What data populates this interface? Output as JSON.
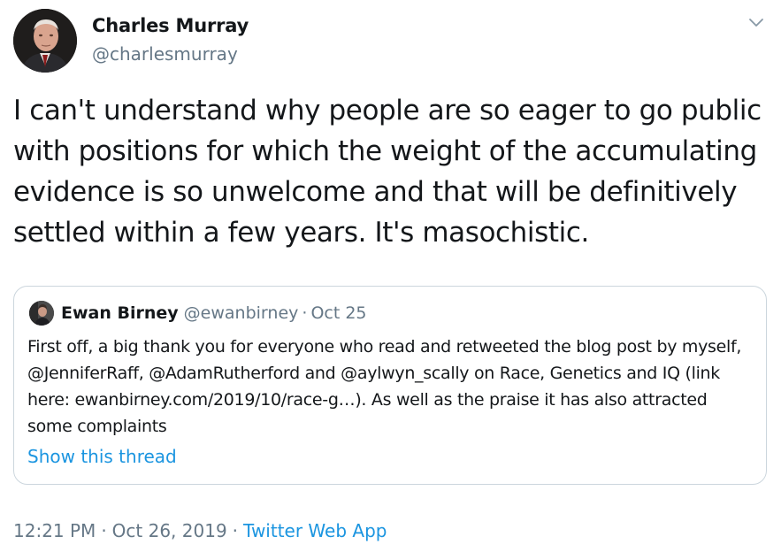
{
  "tweet": {
    "author": {
      "name": "Charles Murray",
      "handle": "@charlesmurray",
      "avatar_icon": "user-photo-avatar"
    },
    "menu_icon": "chevron-down-icon",
    "text": "I can't understand why people are so eager to go public with positions for which the weight of the accumulating evidence is so unwelcome and that will be definitively settled within a few years. It's masochistic.",
    "quoted": {
      "name": "Ewan Birney",
      "handle": "@ewanbirney",
      "separator": "·",
      "date": "Oct 25",
      "text": "First off, a big thank you for everyone who read and retweeted the blog post by myself, @JenniferRaff, @AdamRutherford and @aylwyn_scally on Race, Genetics and IQ (link here: ewanbirney.com/2019/10/race-g…). As well as the praise it has also attracted some complaints",
      "show_thread_label": "Show this thread"
    },
    "meta": {
      "time": "12:21 PM",
      "separator": "·",
      "date": "Oct 26, 2019",
      "separator2": "·",
      "app": "Twitter Web App"
    }
  },
  "colors": {
    "text": "#14171a",
    "secondary": "#657786",
    "link": "#1b95e0",
    "border": "#ccd6dd"
  }
}
